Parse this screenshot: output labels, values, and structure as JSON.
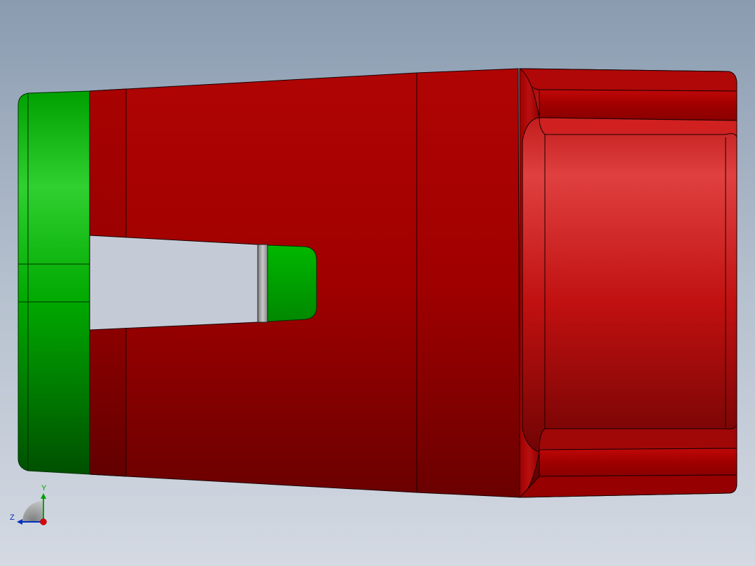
{
  "viewport": {
    "background_top": "#8a9bb0",
    "background_bottom": "#d4d9e2"
  },
  "model": {
    "red_color": "#a00000",
    "green_color": "#00b000",
    "gray_color": "#9a9a9a"
  },
  "triad": {
    "y_label": "Y",
    "z_label": "Z",
    "x_color": "#e00000",
    "y_color": "#00a000",
    "z_color": "#0030c0"
  }
}
